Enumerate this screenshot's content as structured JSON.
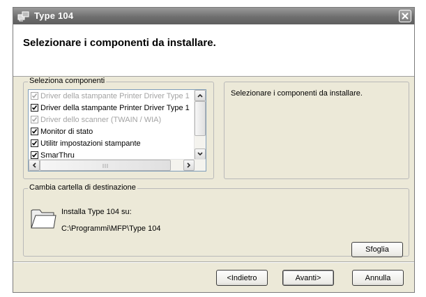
{
  "window": {
    "title": "Type 104",
    "close_icon": "close-icon"
  },
  "header": {
    "title": "Selezionare i componenti da installare."
  },
  "components": {
    "legend": "Seleziona componenti",
    "items": [
      {
        "label": "Driver della stampante Printer Driver Type 1",
        "checked": true,
        "enabled": false
      },
      {
        "label": "Driver della stampante Printer Driver Type 1",
        "checked": true,
        "enabled": true
      },
      {
        "label": "Driver dello scanner (TWAIN / WIA)",
        "checked": true,
        "enabled": false
      },
      {
        "label": "Monitor di stato",
        "checked": true,
        "enabled": true
      },
      {
        "label": "Utilitr impostazioni stampante",
        "checked": true,
        "enabled": true
      },
      {
        "label": "SmarThru",
        "checked": true,
        "enabled": true
      }
    ],
    "scroll_up_icon": "chevron-up-icon",
    "scroll_down_icon": "chevron-down-icon",
    "scroll_left_icon": "chevron-left-icon",
    "scroll_right_icon": "chevron-right-icon"
  },
  "description": {
    "text": "Selezionare i componenti da installare."
  },
  "destination": {
    "legend": "Cambia cartella di destinazione",
    "install_label": "Installa Type 104 su:",
    "path": "C:\\Programmi\\MFP\\Type 104",
    "browse_button": "Sfoglia",
    "folder_icon": "folder-icon"
  },
  "footer": {
    "back_button": "<Indietro",
    "next_button": "Avanti>",
    "cancel_button": "Annulla"
  }
}
